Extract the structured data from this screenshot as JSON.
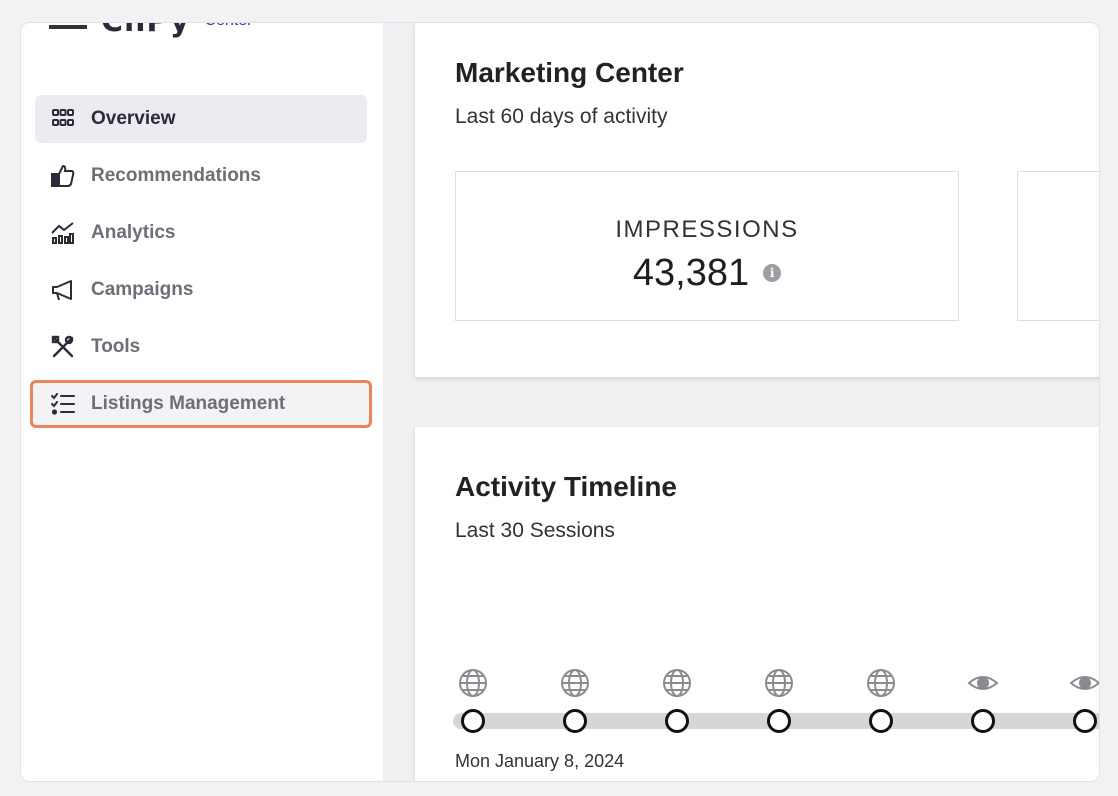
{
  "app": {
    "logo_text": "ChPy",
    "logo_sub": "Center"
  },
  "sidebar": {
    "items": [
      {
        "label": "Overview",
        "icon": "grid-icon"
      },
      {
        "label": "Recommendations",
        "icon": "thumbs-up-icon"
      },
      {
        "label": "Analytics",
        "icon": "analytics-icon"
      },
      {
        "label": "Campaigns",
        "icon": "megaphone-icon"
      },
      {
        "label": "Tools",
        "icon": "tools-icon"
      },
      {
        "label": "Listings Management",
        "icon": "checklist-icon"
      }
    ],
    "active_index": 0,
    "highlighted_index": 5
  },
  "marketing": {
    "title": "Marketing Center",
    "subtitle": "Last 60 days of activity",
    "stat_label": "IMPRESSIONS",
    "stat_value": "43,381"
  },
  "activity": {
    "title": "Activity Timeline",
    "subtitle": "Last 30 Sessions",
    "first_date": "Mon January 8, 2024",
    "events": [
      "globe-icon",
      "globe-icon",
      "globe-icon",
      "globe-icon",
      "globe-icon",
      "eye-icon",
      "eye-icon"
    ]
  },
  "colors": {
    "highlight": "#e9855c",
    "accent": "#2b2b3a"
  }
}
